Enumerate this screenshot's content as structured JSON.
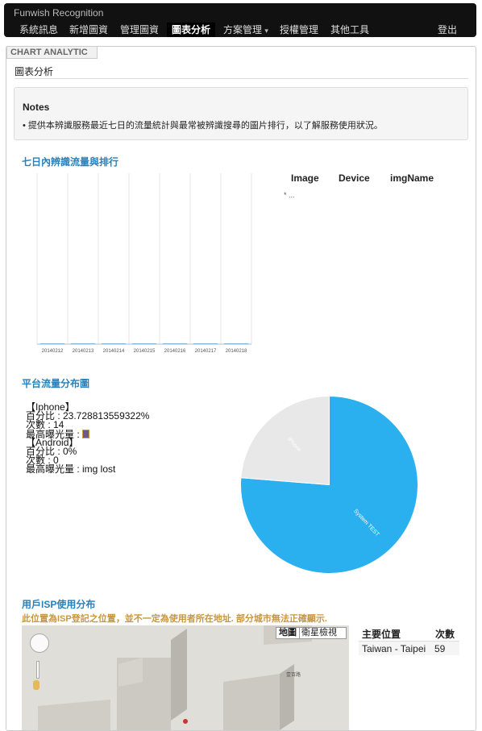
{
  "app": {
    "brand": "Funwish Recognition"
  },
  "nav": {
    "items": [
      {
        "label": "系統訊息"
      },
      {
        "label": "新增圖資"
      },
      {
        "label": "管理圖資"
      },
      {
        "label": "圖表分析"
      },
      {
        "label": "方案管理"
      },
      {
        "label": "授權管理"
      },
      {
        "label": "其他工具"
      }
    ],
    "logout": "登出",
    "dropdown_caret": "▾"
  },
  "page": {
    "tab": "CHART ANALYTIC",
    "title": "圖表分析"
  },
  "notes": {
    "title": "Notes",
    "items": [
      "提供本辨識服務最近七日的流量統計與最常被辨識搜尋的圖片排行，以了解服務使用狀況。"
    ]
  },
  "traffic": {
    "heading": "七日內辨識流量與排行",
    "table": {
      "headers": [
        "Image",
        "Device",
        "imgName"
      ],
      "empty_text": "* ..."
    }
  },
  "platform": {
    "heading": "平台流量分布圖",
    "lines": [
      "【Iphone】",
      "百分比 : 23.728813559322%",
      "次數 : 14",
      "最高曝光量 : ",
      "【Android】",
      "百分比 : 0%",
      "次數 : 0",
      "最高曝光量 : img lost"
    ]
  },
  "isp": {
    "heading": "用戶ISP使用分布",
    "warning": "此位置為ISP登記之位置，並不一定為使用者所在地址. 部分城市無法正確顯示.",
    "map_types": [
      "地圖",
      "衛星檢視"
    ],
    "map_label": "壹百路",
    "table": {
      "headers": [
        "主要位置",
        "次數"
      ],
      "rows": [
        [
          "Taiwan - Taipei",
          "59"
        ]
      ]
    }
  },
  "chart_data": [
    {
      "type": "bar",
      "categories": [
        "20140212",
        "20140213",
        "20140214",
        "20140215",
        "20140216",
        "20140217",
        "20140218"
      ],
      "values": [
        0,
        0,
        0,
        0,
        0,
        0,
        0
      ],
      "title": "",
      "xlabel": "",
      "ylabel": "",
      "grid": true,
      "colors": [
        "#7fb6d8"
      ]
    },
    {
      "type": "pie",
      "categories": [
        "iPhone",
        "System TEST"
      ],
      "values": [
        23.728813559322,
        76.271186440678
      ],
      "colors": [
        "#e8e8e8",
        "#2bb0ef"
      ],
      "label_color": "#ffffff"
    }
  ]
}
